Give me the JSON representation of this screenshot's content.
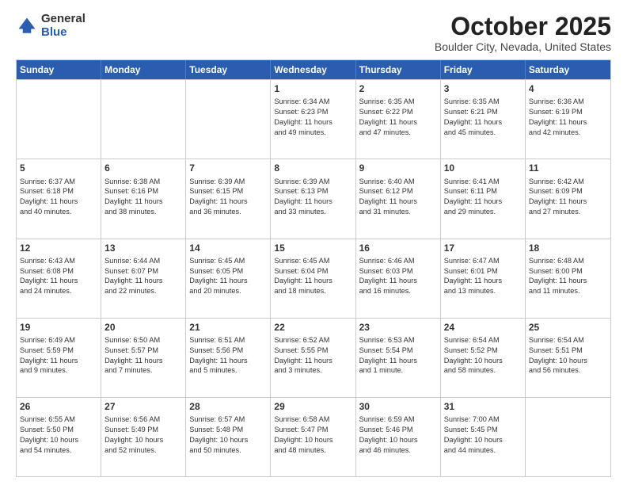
{
  "logo": {
    "general": "General",
    "blue": "Blue"
  },
  "header": {
    "month": "October 2025",
    "location": "Boulder City, Nevada, United States"
  },
  "weekdays": [
    "Sunday",
    "Monday",
    "Tuesday",
    "Wednesday",
    "Thursday",
    "Friday",
    "Saturday"
  ],
  "weeks": [
    [
      {
        "day": "",
        "info": ""
      },
      {
        "day": "",
        "info": ""
      },
      {
        "day": "",
        "info": ""
      },
      {
        "day": "1",
        "info": "Sunrise: 6:34 AM\nSunset: 6:23 PM\nDaylight: 11 hours\nand 49 minutes."
      },
      {
        "day": "2",
        "info": "Sunrise: 6:35 AM\nSunset: 6:22 PM\nDaylight: 11 hours\nand 47 minutes."
      },
      {
        "day": "3",
        "info": "Sunrise: 6:35 AM\nSunset: 6:21 PM\nDaylight: 11 hours\nand 45 minutes."
      },
      {
        "day": "4",
        "info": "Sunrise: 6:36 AM\nSunset: 6:19 PM\nDaylight: 11 hours\nand 42 minutes."
      }
    ],
    [
      {
        "day": "5",
        "info": "Sunrise: 6:37 AM\nSunset: 6:18 PM\nDaylight: 11 hours\nand 40 minutes."
      },
      {
        "day": "6",
        "info": "Sunrise: 6:38 AM\nSunset: 6:16 PM\nDaylight: 11 hours\nand 38 minutes."
      },
      {
        "day": "7",
        "info": "Sunrise: 6:39 AM\nSunset: 6:15 PM\nDaylight: 11 hours\nand 36 minutes."
      },
      {
        "day": "8",
        "info": "Sunrise: 6:39 AM\nSunset: 6:13 PM\nDaylight: 11 hours\nand 33 minutes."
      },
      {
        "day": "9",
        "info": "Sunrise: 6:40 AM\nSunset: 6:12 PM\nDaylight: 11 hours\nand 31 minutes."
      },
      {
        "day": "10",
        "info": "Sunrise: 6:41 AM\nSunset: 6:11 PM\nDaylight: 11 hours\nand 29 minutes."
      },
      {
        "day": "11",
        "info": "Sunrise: 6:42 AM\nSunset: 6:09 PM\nDaylight: 11 hours\nand 27 minutes."
      }
    ],
    [
      {
        "day": "12",
        "info": "Sunrise: 6:43 AM\nSunset: 6:08 PM\nDaylight: 11 hours\nand 24 minutes."
      },
      {
        "day": "13",
        "info": "Sunrise: 6:44 AM\nSunset: 6:07 PM\nDaylight: 11 hours\nand 22 minutes."
      },
      {
        "day": "14",
        "info": "Sunrise: 6:45 AM\nSunset: 6:05 PM\nDaylight: 11 hours\nand 20 minutes."
      },
      {
        "day": "15",
        "info": "Sunrise: 6:45 AM\nSunset: 6:04 PM\nDaylight: 11 hours\nand 18 minutes."
      },
      {
        "day": "16",
        "info": "Sunrise: 6:46 AM\nSunset: 6:03 PM\nDaylight: 11 hours\nand 16 minutes."
      },
      {
        "day": "17",
        "info": "Sunrise: 6:47 AM\nSunset: 6:01 PM\nDaylight: 11 hours\nand 13 minutes."
      },
      {
        "day": "18",
        "info": "Sunrise: 6:48 AM\nSunset: 6:00 PM\nDaylight: 11 hours\nand 11 minutes."
      }
    ],
    [
      {
        "day": "19",
        "info": "Sunrise: 6:49 AM\nSunset: 5:59 PM\nDaylight: 11 hours\nand 9 minutes."
      },
      {
        "day": "20",
        "info": "Sunrise: 6:50 AM\nSunset: 5:57 PM\nDaylight: 11 hours\nand 7 minutes."
      },
      {
        "day": "21",
        "info": "Sunrise: 6:51 AM\nSunset: 5:56 PM\nDaylight: 11 hours\nand 5 minutes."
      },
      {
        "day": "22",
        "info": "Sunrise: 6:52 AM\nSunset: 5:55 PM\nDaylight: 11 hours\nand 3 minutes."
      },
      {
        "day": "23",
        "info": "Sunrise: 6:53 AM\nSunset: 5:54 PM\nDaylight: 11 hours\nand 1 minute."
      },
      {
        "day": "24",
        "info": "Sunrise: 6:54 AM\nSunset: 5:52 PM\nDaylight: 10 hours\nand 58 minutes."
      },
      {
        "day": "25",
        "info": "Sunrise: 6:54 AM\nSunset: 5:51 PM\nDaylight: 10 hours\nand 56 minutes."
      }
    ],
    [
      {
        "day": "26",
        "info": "Sunrise: 6:55 AM\nSunset: 5:50 PM\nDaylight: 10 hours\nand 54 minutes."
      },
      {
        "day": "27",
        "info": "Sunrise: 6:56 AM\nSunset: 5:49 PM\nDaylight: 10 hours\nand 52 minutes."
      },
      {
        "day": "28",
        "info": "Sunrise: 6:57 AM\nSunset: 5:48 PM\nDaylight: 10 hours\nand 50 minutes."
      },
      {
        "day": "29",
        "info": "Sunrise: 6:58 AM\nSunset: 5:47 PM\nDaylight: 10 hours\nand 48 minutes."
      },
      {
        "day": "30",
        "info": "Sunrise: 6:59 AM\nSunset: 5:46 PM\nDaylight: 10 hours\nand 46 minutes."
      },
      {
        "day": "31",
        "info": "Sunrise: 7:00 AM\nSunset: 5:45 PM\nDaylight: 10 hours\nand 44 minutes."
      },
      {
        "day": "",
        "info": ""
      }
    ]
  ]
}
